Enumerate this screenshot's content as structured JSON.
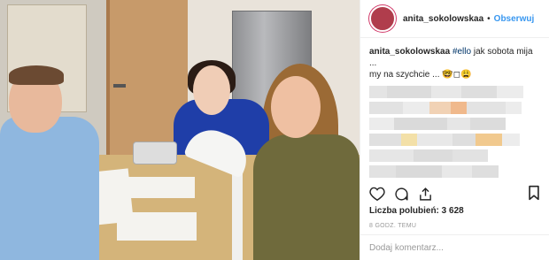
{
  "header": {
    "username": "anita_sokolowskaa",
    "separator": "•",
    "follow_label": "Obserwuj"
  },
  "caption": {
    "username": "anita_sokolowskaa",
    "hashtag": "#ello",
    "text_line1": " jak sobota mija ...",
    "text_line2": "my na szychcie ... 🤓◻😩"
  },
  "likes": {
    "label": "Liczba polubień: 3 628"
  },
  "date": "8 GODZ. TEMU",
  "comment": {
    "placeholder": "Dodaj komentarz..."
  },
  "icons": [
    "heart-icon",
    "comment-icon",
    "share-icon",
    "bookmark-icon",
    "more-icon"
  ],
  "colors": {
    "follow": "#3897f0",
    "avatar_ring": "#d23c6b",
    "text": "#262626",
    "muted": "#999999"
  }
}
